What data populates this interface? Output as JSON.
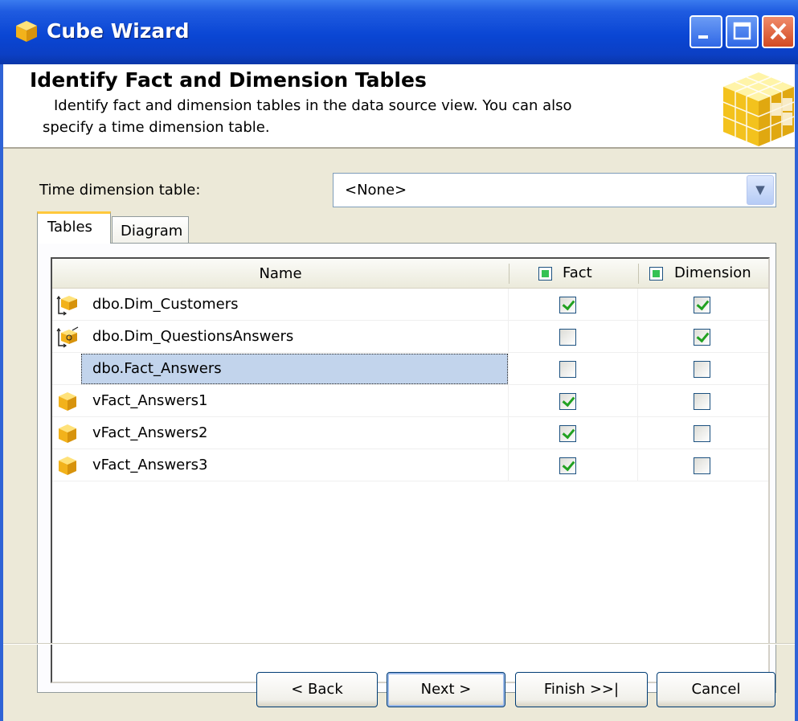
{
  "window": {
    "title": "Cube Wizard"
  },
  "header": {
    "title": "Identify Fact and Dimension Tables",
    "description": "Identify fact and dimension tables in the data source view. You can also specify a time dimension table."
  },
  "time_dimension": {
    "label": "Time dimension table:",
    "value": "<None>"
  },
  "tabs": [
    {
      "label": "Tables",
      "active": true
    },
    {
      "label": "Diagram",
      "active": false
    }
  ],
  "grid": {
    "columns": {
      "name": "Name",
      "fact": "Fact",
      "dimension": "Dimension"
    },
    "rows": [
      {
        "name": "dbo.Dim_Customers",
        "icon": "dimension-table-icon",
        "fact": true,
        "dimension": true
      },
      {
        "name": "dbo.Dim_QuestionsAnswers",
        "icon": "dimension-table-icon",
        "fact": false,
        "dimension": true
      },
      {
        "name": "dbo.Fact_Answers",
        "icon": "none",
        "fact": false,
        "dimension": false,
        "selected": true
      },
      {
        "name": "vFact_Answers1",
        "icon": "fact-table-icon",
        "fact": true,
        "dimension": false
      },
      {
        "name": "vFact_Answers2",
        "icon": "fact-table-icon",
        "fact": true,
        "dimension": false
      },
      {
        "name": "vFact_Answers3",
        "icon": "fact-table-icon",
        "fact": true,
        "dimension": false
      }
    ]
  },
  "buttons": {
    "back": "< Back",
    "next": "Next >",
    "finish": "Finish >>|",
    "cancel": "Cancel"
  },
  "colors": {
    "titlebar": "#0a46d4",
    "dialog_bg": "#ece9d8",
    "selection": "#c2d4ec",
    "check": "#21a121"
  }
}
